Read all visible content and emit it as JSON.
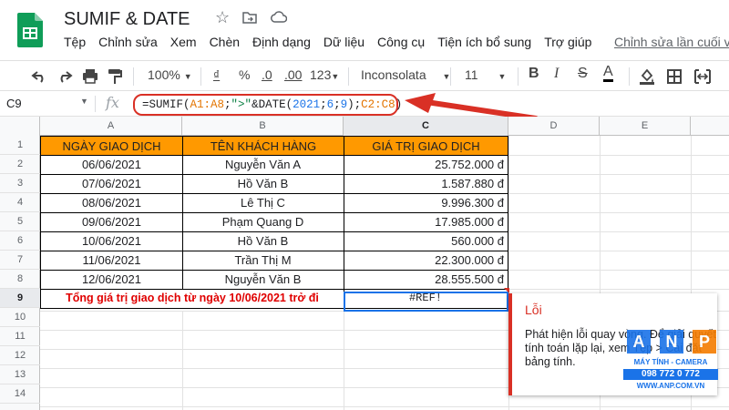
{
  "app": {
    "title": "SUMIF & DATE",
    "last_edit": "Chỉnh sửa lần cuối v"
  },
  "menu": [
    "Tệp",
    "Chỉnh sửa",
    "Xem",
    "Chèn",
    "Định dạng",
    "Dữ liệu",
    "Công cụ",
    "Tiện ích bổ sung",
    "Trợ giúp"
  ],
  "toolbar": {
    "zoom": "100%",
    "currency": "₫",
    "percent": "%",
    "dec_less": ".0",
    "dec_more": ".00",
    "format": "123",
    "font": "Inconsolata",
    "font_size": "11",
    "bold": "B",
    "italic": "I",
    "strike": "S",
    "text_color": "A"
  },
  "formula_bar": {
    "cell_ref": "C9",
    "fx": "fx",
    "formula_parts": {
      "p1": "=SUMIF(",
      "p2": "A1:A8",
      "p3": ";",
      "p4": "\">\"",
      "p5": "&DATE(",
      "p6": "2021",
      "p7": ";",
      "p8": "6",
      "p9": ";",
      "p10": "9",
      "p11": ");",
      "p12": "C2:C8",
      "p13": ")"
    }
  },
  "columns": [
    "A",
    "B",
    "C",
    "D",
    "E"
  ],
  "rows": [
    "1",
    "2",
    "3",
    "4",
    "5",
    "6",
    "7",
    "8",
    "9",
    "10",
    "11",
    "12",
    "13",
    "14"
  ],
  "sheet": {
    "headers": [
      "NGÀY GIAO DỊCH",
      "TÊN KHÁCH HÀNG",
      "GIÁ TRỊ GIAO DỊCH"
    ],
    "data": [
      [
        "06/06/2021",
        "Nguyễn Văn A",
        "25.752.000 đ"
      ],
      [
        "07/06/2021",
        "Hồ Văn B",
        "1.587.880 đ"
      ],
      [
        "08/06/2021",
        "Lê Thị C",
        "9.996.300 đ"
      ],
      [
        "09/06/2021",
        "Phạm Quang D",
        "17.985.000 đ"
      ],
      [
        "10/06/2021",
        "Hồ Văn B",
        "560.000 đ"
      ],
      [
        "11/06/2021",
        "Trần Thị M",
        "22.300.000 đ"
      ],
      [
        "12/06/2021",
        "Nguyễn Văn B",
        "28.555.500 đ"
      ]
    ],
    "total_label": "Tổng giá trị giao dịch từ ngày 10/06/2021 trở đi",
    "total_value": "#REF!"
  },
  "error_tooltip": {
    "title": "Lỗi",
    "body": "Phát hiện lỗi quay vòng. Để giải quyết tính toán lặp lại, xem Tệp > Cài đặt bảng tính."
  },
  "watermark": {
    "tiles": [
      "A",
      "N",
      "P"
    ],
    "line1": "MÁY TÍNH - CAMERA",
    "phone": "098 772 0 772",
    "url": "WWW.ANP.COM.VN"
  },
  "colors": {
    "header_fill": "#ff9900",
    "error_red": "#d93025",
    "selection_blue": "#1a73e8"
  }
}
